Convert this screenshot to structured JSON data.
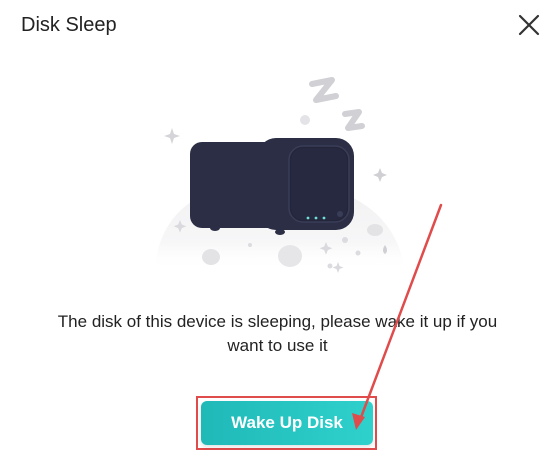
{
  "dialog": {
    "title": "Disk Sleep",
    "close_icon": "close-icon",
    "message_line1": "The disk of this device is sleeping, please wake it up if you",
    "message_line2": "want to use it",
    "wake_button_label": "Wake Up Disk"
  },
  "illustration": {
    "icon": "sleeping-device-illustration",
    "sleep_symbol": "zzz-icon"
  },
  "colors": {
    "accent": "#2fc6c3",
    "annotation": "#e04b4b",
    "device": "#2b2e45"
  }
}
